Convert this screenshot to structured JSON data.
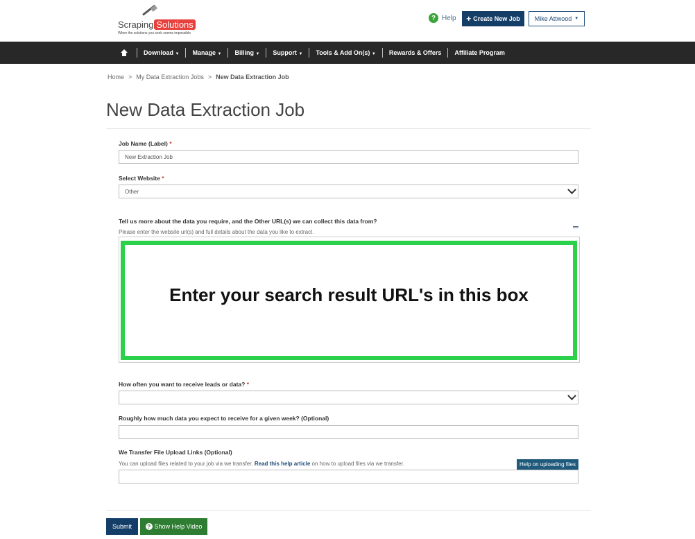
{
  "header": {
    "logo_text": "Scraping",
    "logo_accent": "Solutions",
    "logo_tagline": "When the solutions you seek seems impossible",
    "help_label": "Help",
    "create_job_label": "Create New Job",
    "user_menu_label": "Mike Attwood"
  },
  "nav": {
    "items": [
      {
        "label": "Download"
      },
      {
        "label": "Manage"
      },
      {
        "label": "Billing"
      },
      {
        "label": "Support"
      },
      {
        "label": "Tools & Add On(s)"
      },
      {
        "label": "Rewards & Offers"
      },
      {
        "label": "Affiliate Program"
      }
    ]
  },
  "breadcrumb": {
    "home": "Home",
    "jobs": "My Data Extraction Jobs",
    "current": "New Data Extraction Job"
  },
  "page_title": "New Data Extraction Job",
  "form": {
    "job_name_label": "Job Name (Label)",
    "job_name_value": "New Extraction Job",
    "website_label": "Select Website",
    "website_value": "Other",
    "details_label": "Tell us more about the data you require, and the Other URL(s) we can collect this data from?",
    "details_hint": "Please enter the website url(s) and full details about the data you like to extract.",
    "overlay_text": "Enter your search result URL's in this box",
    "frequency_label": "How often you want to receive leads or data?",
    "frequency_value": "",
    "volume_label": "Roughly how much data you expect to receive for a given week? (Optional)",
    "volume_value": "",
    "upload_label": "We Transfer File Upload Links (Optional)",
    "upload_hint_pre": "You can upload files related to your job via we transfer.",
    "upload_hint_link": "Read this help article",
    "upload_hint_post": "on how to upload files via we transfer.",
    "upload_help_button": "Help on uploading files",
    "upload_value": "",
    "required_mark": "*"
  },
  "actions": {
    "submit_label": "Submit",
    "help_video_label": "Show Help Video"
  },
  "colors": {
    "primary": "#143e68",
    "success": "#2e7d32",
    "highlight": "#2bd14a",
    "nav_bg": "#282828",
    "logo_red": "#e8403c"
  }
}
